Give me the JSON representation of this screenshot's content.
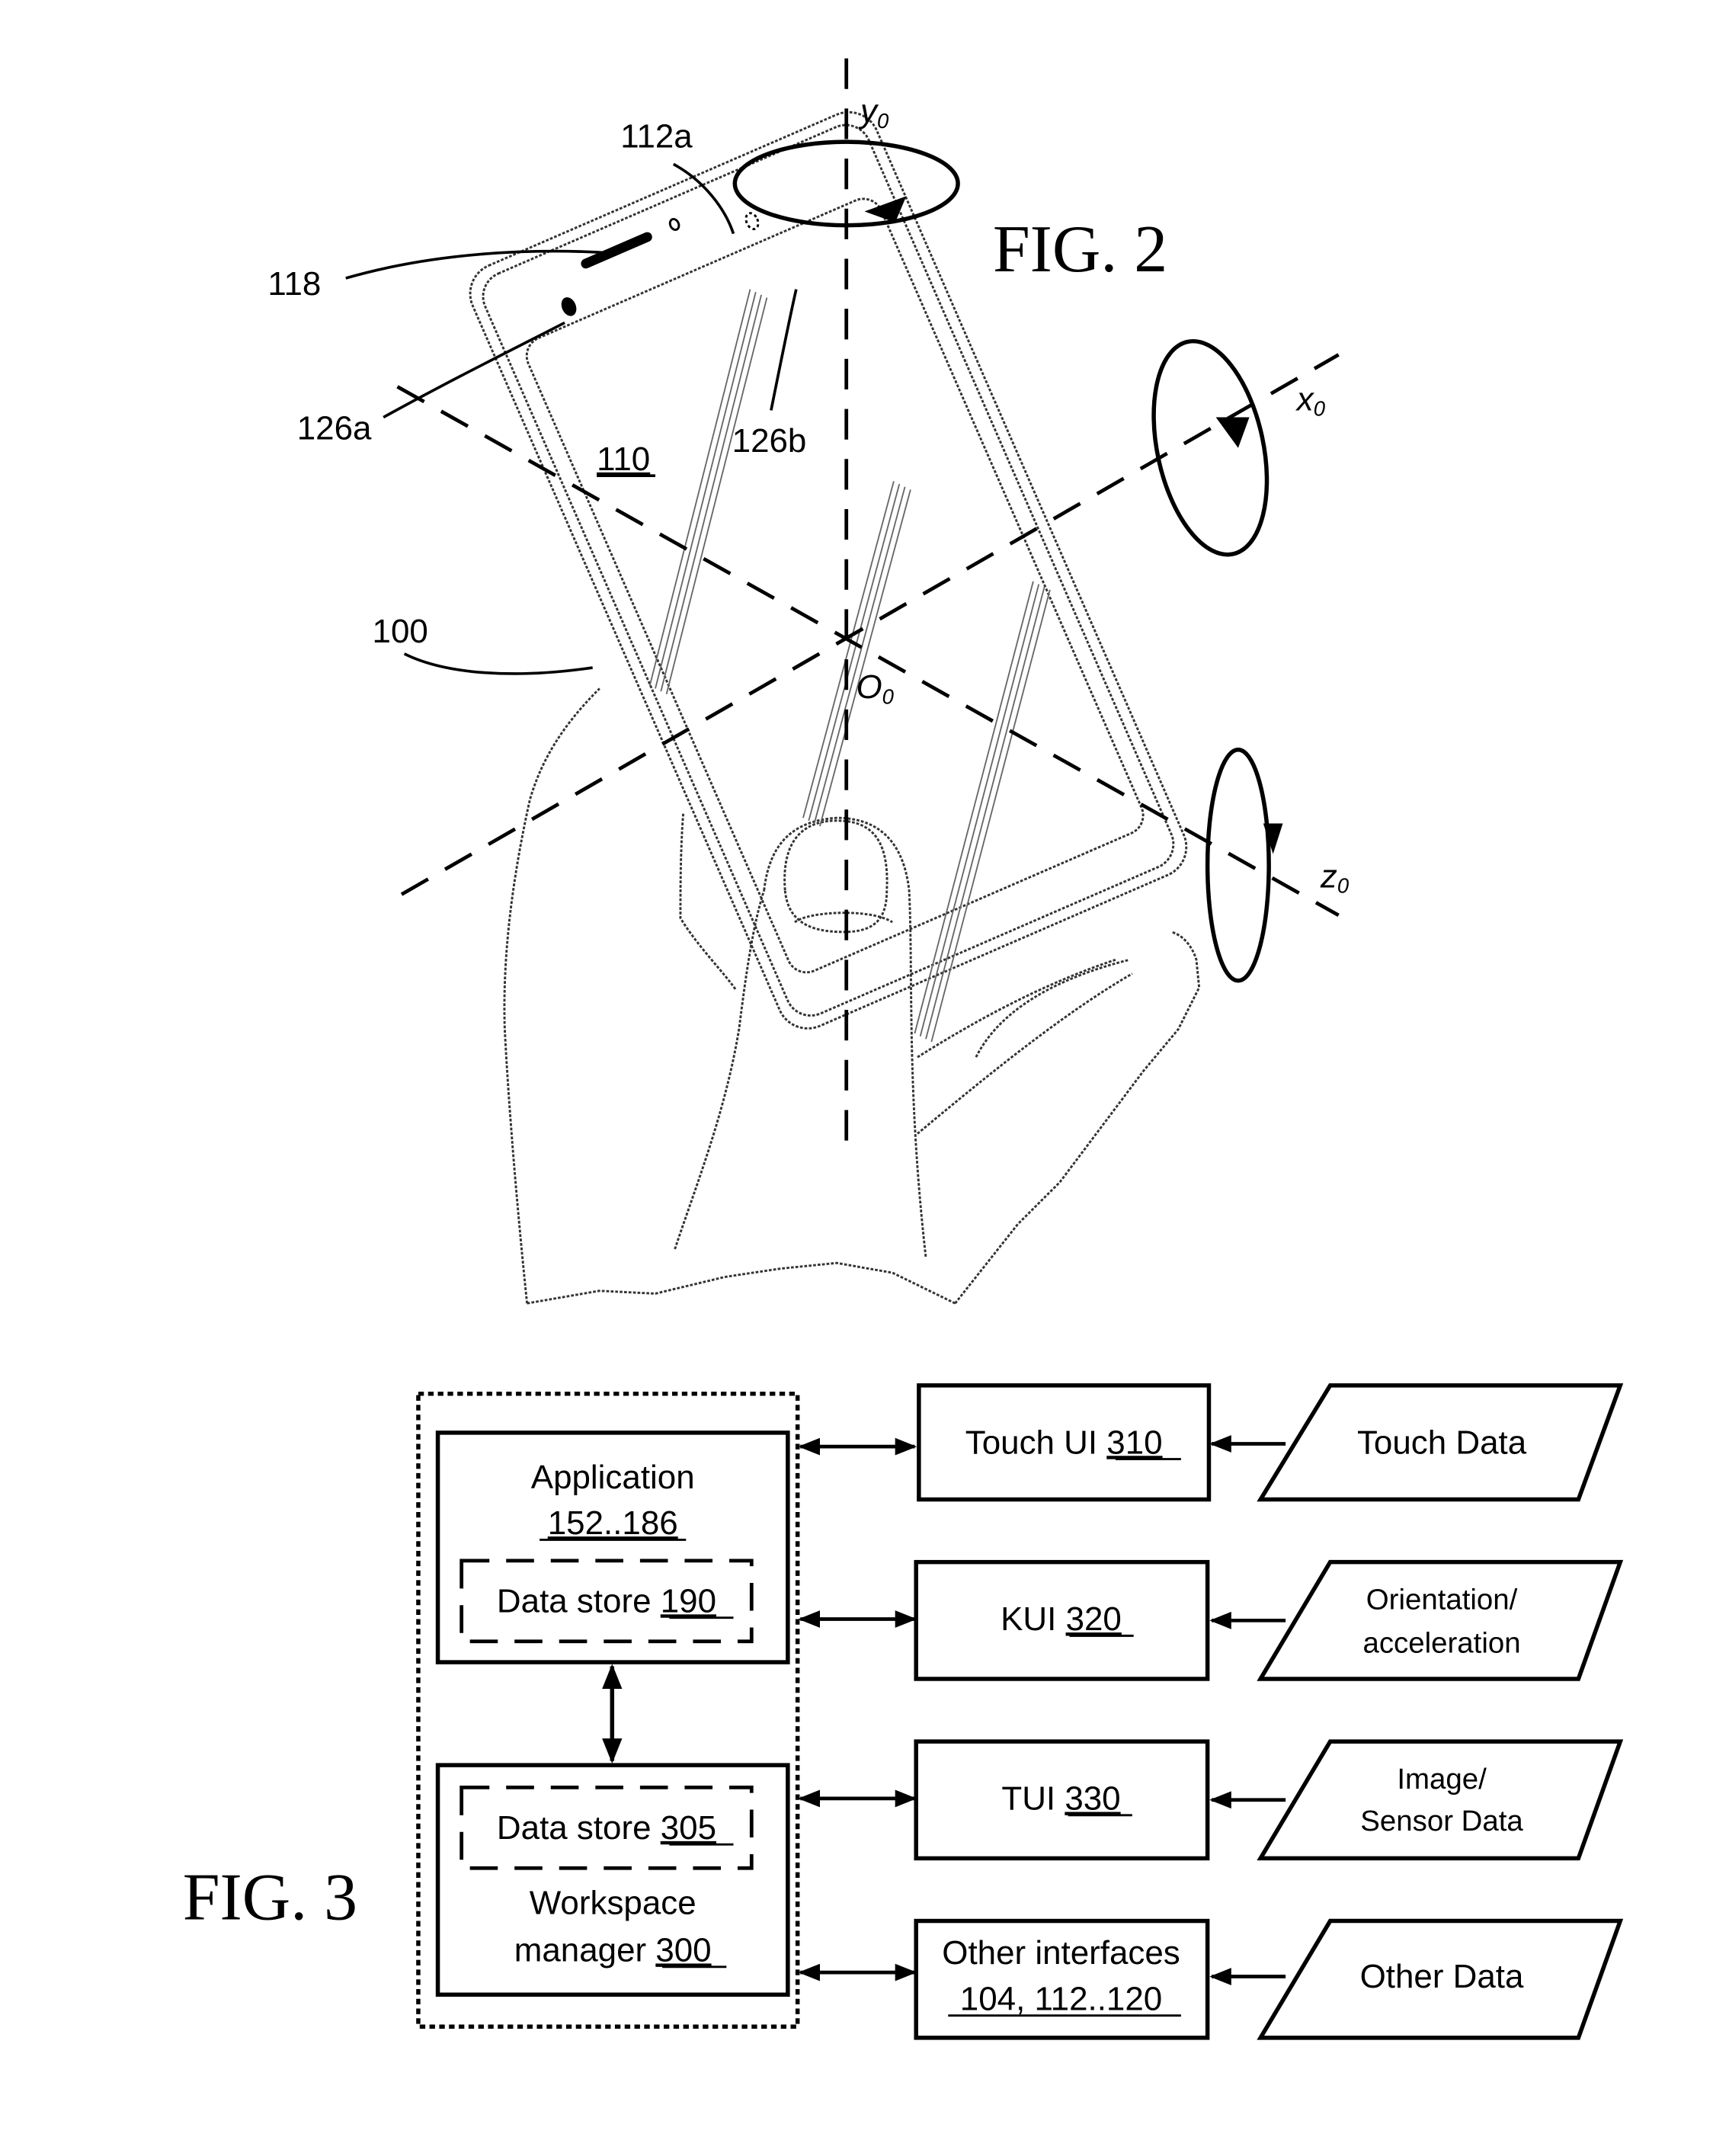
{
  "fig2": {
    "title": "FIG. 2",
    "labels": {
      "y_axis": "y",
      "y_sub": "0",
      "x_axis": "x",
      "x_sub": "0",
      "z_axis": "z",
      "z_sub": "0",
      "origin": "O",
      "origin_sub": "0",
      "ref_112a": "112a",
      "ref_118": "118",
      "ref_126a": "126a",
      "ref_126b": "126b",
      "ref_110": "110",
      "ref_100": "100"
    }
  },
  "fig3": {
    "title": "FIG. 3",
    "application": {
      "line1": "Application",
      "ref": "152..186"
    },
    "app_store": {
      "label": "Data store ",
      "ref": "190"
    },
    "wm_store": {
      "label": "Data store ",
      "ref": "305"
    },
    "workspace_manager": {
      "line1": "Workspace",
      "line2": "manager ",
      "ref": "300"
    },
    "interfaces": [
      {
        "label": "Touch UI ",
        "ref": "310"
      },
      {
        "label": "KUI ",
        "ref": "320"
      },
      {
        "label": "TUI ",
        "ref": "330"
      },
      {
        "label": "Other interfaces",
        "ref": "104, 112..120"
      }
    ],
    "data_sources": [
      {
        "line1": "Touch Data",
        "line2": ""
      },
      {
        "line1": "Orientation/",
        "line2": "acceleration"
      },
      {
        "line1": "Image/",
        "line2": "Sensor Data"
      },
      {
        "line1": "Other Data",
        "line2": ""
      }
    ]
  }
}
